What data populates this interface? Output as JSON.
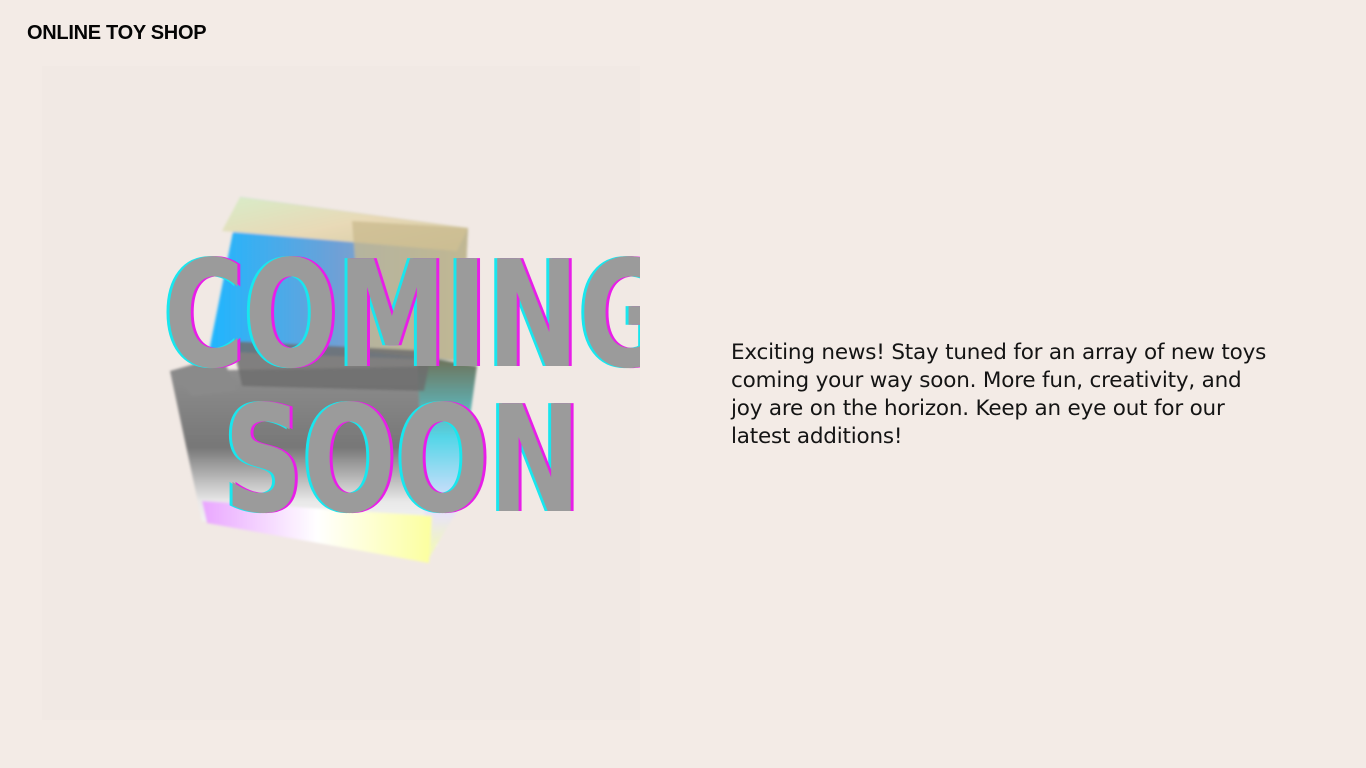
{
  "header": {
    "logo_text": "ONLINE TOY SHOP"
  },
  "hero": {
    "headline_line1": "COMING",
    "headline_line2": "SOON",
    "graphic": "holographic-cube",
    "colors": {
      "text_fill": "#9b9b9b",
      "offset_cyan": "#19e6ee",
      "offset_magenta": "#e81ee8",
      "background": "#f3ebe6"
    }
  },
  "main": {
    "description": "Exciting news! Stay tuned for an array of new toys coming your way soon. More fun, creativity, and joy are on the horizon. Keep an eye out for our latest additions!"
  }
}
